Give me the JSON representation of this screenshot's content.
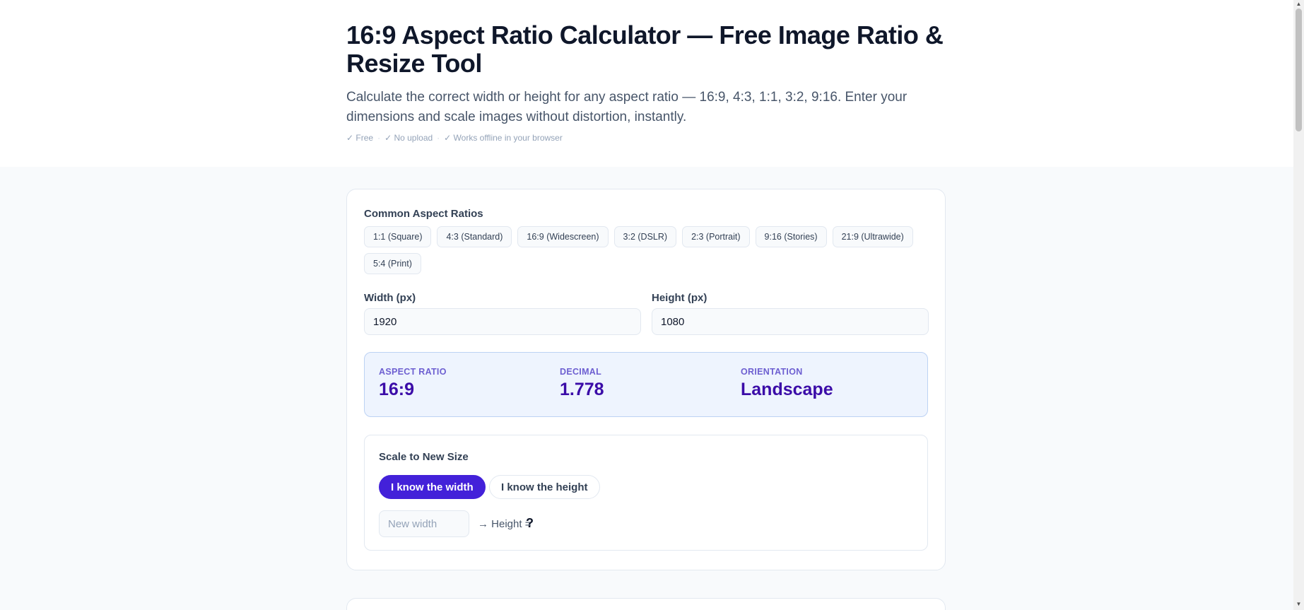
{
  "hero": {
    "title": "16:9 Aspect Ratio Calculator — Free Image Ratio & Resize Tool",
    "subtitle": "Calculate the correct width or height for any aspect ratio — 16:9, 4:3, 1:1, 3:2, 9:16. Enter your dimensions and scale images without distortion, instantly.",
    "badges": [
      "✓ Free",
      "✓ No upload",
      "✓ Works offline in your browser"
    ],
    "separator": "·"
  },
  "ratios": {
    "label": "Common Aspect Ratios",
    "items": [
      "1:1 (Square)",
      "4:3 (Standard)",
      "16:9 (Widescreen)",
      "3:2 (DSLR)",
      "2:3 (Portrait)",
      "9:16 (Stories)",
      "21:9 (Ultrawide)",
      "5:4 (Print)"
    ]
  },
  "dimensions": {
    "width_label": "Width (px)",
    "width_value": "1920",
    "height_label": "Height (px)",
    "height_value": "1080"
  },
  "result": {
    "aspect_label": "ASPECT RATIO",
    "aspect_value": "16:9",
    "decimal_label": "DECIMAL",
    "decimal_value": "1.778",
    "orientation_label": "ORIENTATION",
    "orientation_value": "Landscape"
  },
  "scale": {
    "title": "Scale to New Size",
    "width_mode": "I know the width",
    "height_mode": "I know the height",
    "input_placeholder": "New width",
    "arrow_text": "→ Height =",
    "result": "?"
  },
  "colors": {
    "accent": "#4321d9",
    "result_bg": "#eef4fe",
    "result_text": "#3b0ca8"
  }
}
